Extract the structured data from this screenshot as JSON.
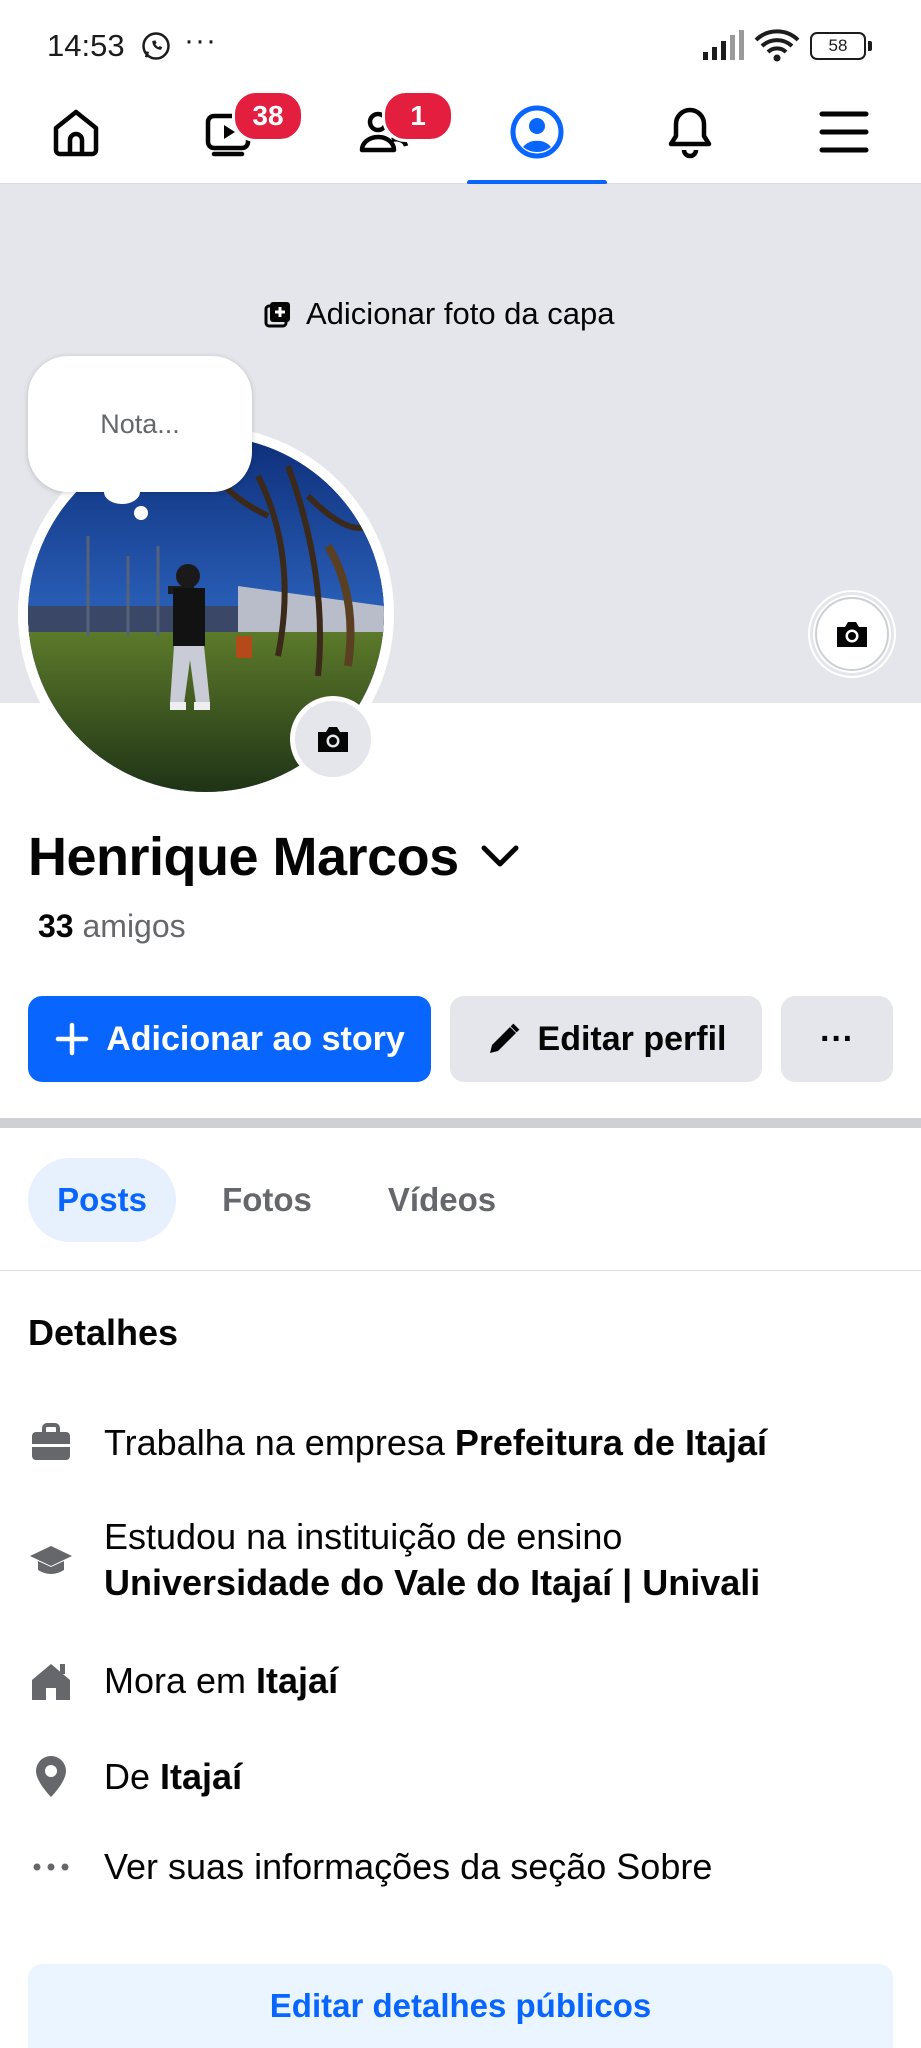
{
  "status_bar": {
    "time": "14:53",
    "more": "···",
    "battery": "58"
  },
  "nav": {
    "items": [
      {
        "name": "home",
        "badge": ""
      },
      {
        "name": "video",
        "badge": "38"
      },
      {
        "name": "friends",
        "badge": "1"
      },
      {
        "name": "profile",
        "badge": "",
        "active": true
      },
      {
        "name": "notifications",
        "badge": ""
      },
      {
        "name": "menu",
        "badge": ""
      }
    ]
  },
  "cover": {
    "add_cover_label": "Adicionar foto da capa"
  },
  "note": {
    "placeholder": "Nota..."
  },
  "profile": {
    "name": "Henrique Marcos",
    "friends_count": "33",
    "friends_label": "amigos"
  },
  "actions": {
    "story_label": "Adicionar ao story",
    "edit_label": "Editar perfil",
    "more_label": "···"
  },
  "tabs": [
    {
      "label": "Posts",
      "active": true
    },
    {
      "label": "Fotos"
    },
    {
      "label": "Vídeos"
    }
  ],
  "details": {
    "title": "Detalhes",
    "work": {
      "prefix": "Trabalha na empresa ",
      "value": "Prefeitura de Itajaí"
    },
    "education": {
      "prefix": "Estudou na instituição de ensino",
      "value": "Universidade do Vale do Itajaí | Univali"
    },
    "lives": {
      "prefix": "Mora em ",
      "value": "Itajaí"
    },
    "from": {
      "prefix": "De ",
      "value": "Itajaí"
    },
    "about": {
      "label": "Ver suas informações da seção Sobre"
    },
    "edit_public_label": "Editar detalhes públicos"
  },
  "colors": {
    "accent": "#0866ff",
    "badge": "#e41e3f",
    "cover": "#e4e6eb",
    "secondary_button": "#e4e6eb"
  },
  "icons": [
    "whatsapp-icon",
    "signal-icon",
    "wifi-icon",
    "battery-icon",
    "home-icon",
    "video-icon",
    "friends-icon",
    "profile-icon",
    "bell-icon",
    "menu-icon",
    "add-photo-icon",
    "camera-icon",
    "chevron-down-icon",
    "plus-icon",
    "pencil-icon",
    "briefcase-icon",
    "graduation-cap-icon",
    "house-icon",
    "location-pin-icon",
    "more-dots-icon"
  ]
}
